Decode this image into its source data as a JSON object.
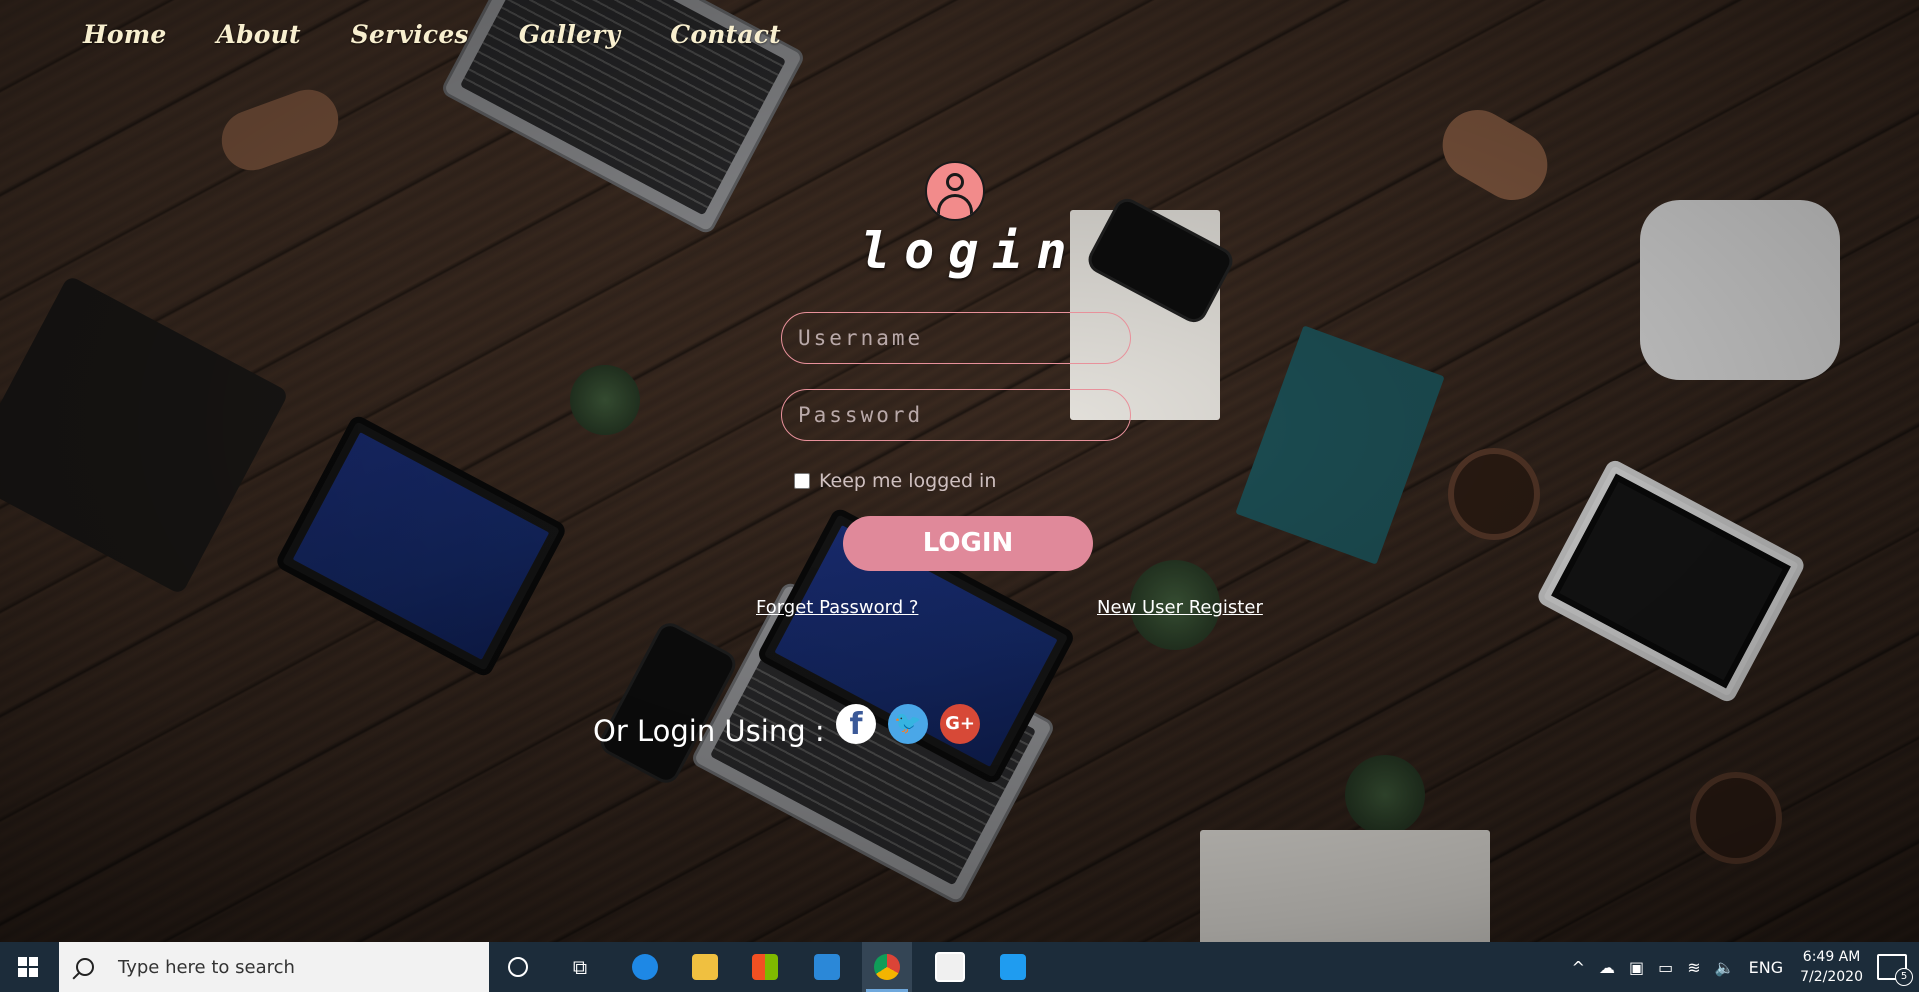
{
  "nav": {
    "items": [
      {
        "label": "Home"
      },
      {
        "label": "About"
      },
      {
        "label": "Services"
      },
      {
        "label": "Gallery"
      },
      {
        "label": "Contact"
      }
    ]
  },
  "login": {
    "title": "login",
    "username_placeholder": "Username",
    "password_placeholder": "Password",
    "keep_logged_in": "Keep me logged in",
    "button": "LOGIN",
    "forget_password": "Forget Password ?",
    "register": "New User Register",
    "or_login_using": "Or Login Using :",
    "social": {
      "facebook": "f",
      "twitter": "🐦",
      "google": "G+"
    }
  },
  "colors": {
    "accent": "#e0899a",
    "avatar": "#f28b8b",
    "nav_text": "#f8efcf",
    "taskbar": "#1c2c3a"
  },
  "taskbar": {
    "search_placeholder": "Type here to search",
    "apps": [
      "edge-icon",
      "file-explorer-icon",
      "store-icon",
      "mail-icon",
      "chrome-icon",
      "photos-icon",
      "vscode-icon"
    ],
    "language": "ENG",
    "time": "6:49 AM",
    "date": "7/2/2020",
    "notifications": "5"
  }
}
